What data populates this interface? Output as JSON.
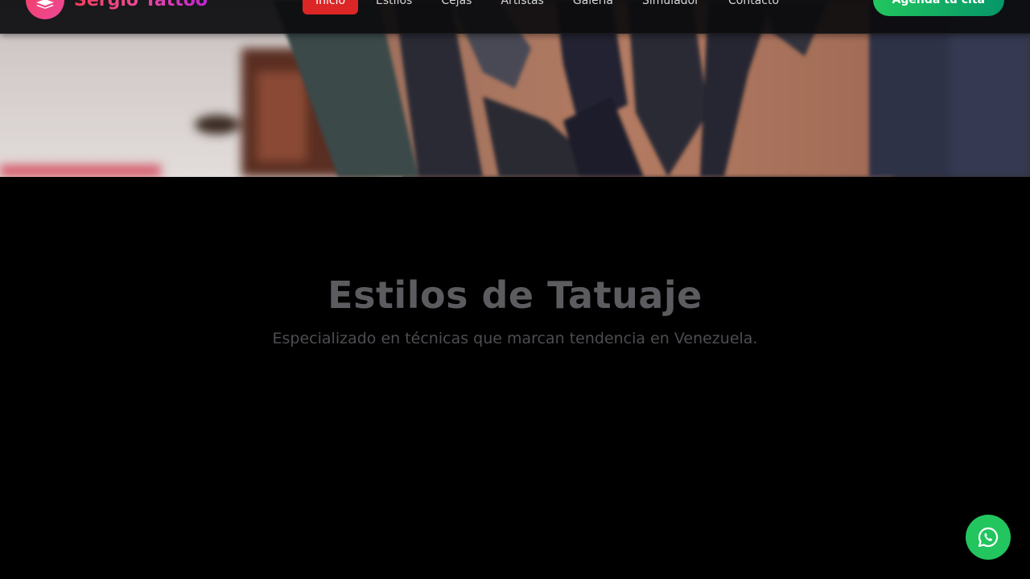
{
  "brand": {
    "name": "Sergio Tattoo",
    "logo_icon": "layers-icon"
  },
  "nav": {
    "items": [
      {
        "label": "Inicio",
        "active": true
      },
      {
        "label": "Estilos",
        "active": false
      },
      {
        "label": "Cejas",
        "active": false
      },
      {
        "label": "Artistas",
        "active": false
      },
      {
        "label": "Galería",
        "active": false
      },
      {
        "label": "Simulador",
        "active": false
      },
      {
        "label": "Contacto",
        "active": false
      }
    ],
    "cta_label": "Agenda tu cita"
  },
  "hero": {
    "image": "blurred-tattoo-photo"
  },
  "styles_section": {
    "title": "Estilos de Tatuaje",
    "subtitle": "Especializado en técnicas que marcan tendencia en Venezuela."
  },
  "floating": {
    "whatsapp_icon": "whatsapp-icon"
  },
  "colors": {
    "accent_active": "#dc2626",
    "cta_green": "#22c55e",
    "brand_pink": "#ec4899",
    "whatsapp_green": "#22c55e"
  }
}
